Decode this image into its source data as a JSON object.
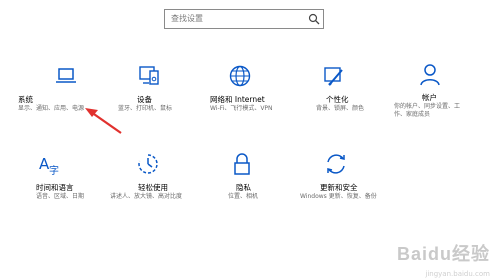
{
  "search": {
    "placeholder": "查找设置"
  },
  "tiles": [
    {
      "title": "系统",
      "desc": "显示、通知、应用、电源",
      "icon": "laptop-icon"
    },
    {
      "title": "设备",
      "desc": "蓝牙、打印机、鼠标",
      "icon": "devices-icon"
    },
    {
      "title": "网络和 Internet",
      "desc": "Wi-Fi、飞行模式、VPN",
      "icon": "globe-icon"
    },
    {
      "title": "个性化",
      "desc": "背景、锁屏、颜色",
      "icon": "paint-icon"
    },
    {
      "title": "帐户",
      "desc": "你的帐户、同步设置、工作、家庭成员",
      "icon": "person-icon"
    },
    {
      "title": "时间和语言",
      "desc": "语音、区域、日期",
      "icon": "time-language-icon"
    },
    {
      "title": "轻松使用",
      "desc": "讲述人、放大镜、高对比度",
      "icon": "ease-of-access-icon"
    },
    {
      "title": "隐私",
      "desc": "位置、相机",
      "icon": "lock-icon"
    },
    {
      "title": "更新和安全",
      "desc": "Windows 更新、恢复、备份",
      "icon": "update-icon"
    }
  ],
  "watermark": {
    "text": "Baidu经验",
    "sub": "jingyan.baidu.com"
  },
  "colors": {
    "icon": "#0a58c7",
    "arrow": "#e1312e"
  }
}
